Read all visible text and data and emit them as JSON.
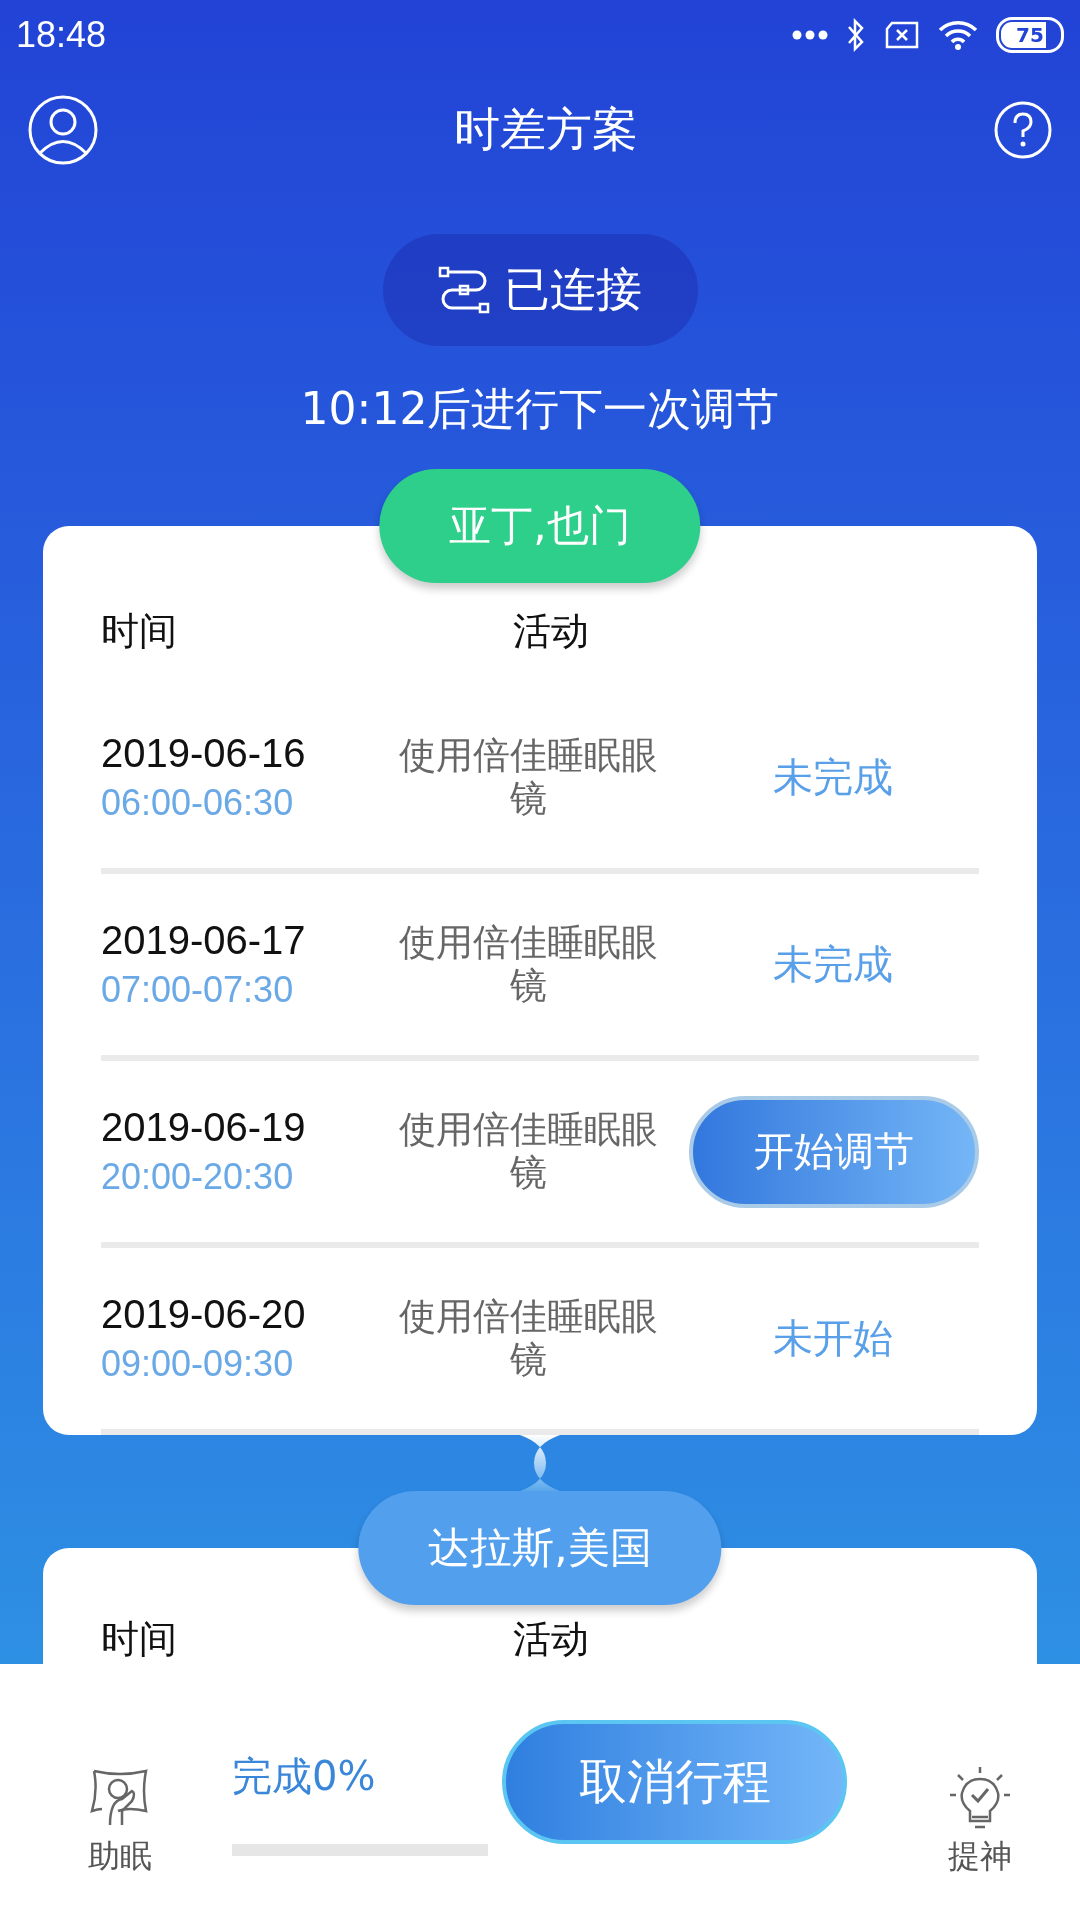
{
  "status_bar": {
    "time": "18:48",
    "battery": "75"
  },
  "header": {
    "title": "时差方案"
  },
  "connection": {
    "label": "已连接"
  },
  "countdown": "10:12后进行下一次调节",
  "legs": [
    {
      "city": "亚丁,也门",
      "selected": false,
      "columns": [
        "时间",
        "活动"
      ],
      "rows": [
        {
          "date": "2019-06-16",
          "time": "06:00-06:30",
          "activity": "使用倍佳睡眠眼镜",
          "kind": "status",
          "status": "未完成"
        },
        {
          "date": "2019-06-17",
          "time": "07:00-07:30",
          "activity": "使用倍佳睡眠眼镜",
          "kind": "status",
          "status": "未完成"
        },
        {
          "date": "2019-06-19",
          "time": "20:00-20:30",
          "activity": "使用倍佳睡眠眼镜",
          "kind": "button",
          "status": "开始调节"
        },
        {
          "date": "2019-06-20",
          "time": "09:00-09:30",
          "activity": "使用倍佳睡眠眼镜",
          "kind": "status",
          "status": "未开始"
        }
      ]
    },
    {
      "city": "达拉斯,美国",
      "selected": true,
      "columns": [
        "时间",
        "活动"
      ]
    }
  ],
  "bottom_bar": {
    "left_label": "助眠",
    "progress_label": "完成0%",
    "level": 0,
    "cancel_button": "取消行程",
    "right_label": "提神"
  }
}
